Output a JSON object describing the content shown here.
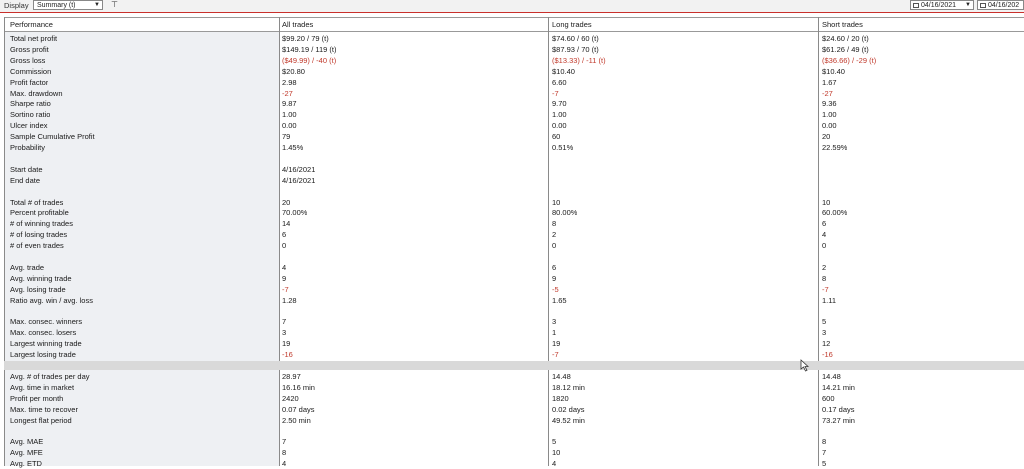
{
  "toolbar": {
    "display_label": "Display",
    "display_value": "Summary (t)",
    "date_from": "04/16/2021",
    "date_to": "04/16/202"
  },
  "columns": [
    "Performance",
    "All trades",
    "Long trades",
    "Short trades"
  ],
  "rows": [
    {
      "label": "Total net profit",
      "all": "$99.20 / 79 (t)",
      "long": "$74.60 / 60 (t)",
      "short": "$24.60 / 20 (t)",
      "neg": false
    },
    {
      "label": "Gross profit",
      "all": "$149.19 / 119 (t)",
      "long": "$87.93 / 70 (t)",
      "short": "$61.26 / 49 (t)",
      "neg": false
    },
    {
      "label": "Gross loss",
      "all": "($49.99) / -40 (t)",
      "long": "($13.33) / -11 (t)",
      "short": "($36.66) / -29 (t)",
      "neg": true
    },
    {
      "label": "Commission",
      "all": "$20.80",
      "long": "$10.40",
      "short": "$10.40",
      "neg": false
    },
    {
      "label": "Profit factor",
      "all": "2.98",
      "long": "6.60",
      "short": "1.67",
      "neg": false
    },
    {
      "label": "Max. drawdown",
      "all": "-27",
      "long": "-7",
      "short": "-27",
      "neg": true
    },
    {
      "label": "Sharpe ratio",
      "all": "9.87",
      "long": "9.70",
      "short": "9.36",
      "neg": false
    },
    {
      "label": "Sortino ratio",
      "all": "1.00",
      "long": "1.00",
      "short": "1.00",
      "neg": false
    },
    {
      "label": "Ulcer index",
      "all": "0.00",
      "long": "0.00",
      "short": "0.00",
      "neg": false
    },
    {
      "label": "Sample Cumulative Profit",
      "all": "79",
      "long": "60",
      "short": "20",
      "neg": false
    },
    {
      "label": "Probability",
      "all": "1.45%",
      "long": "0.51%",
      "short": "22.59%",
      "neg": false
    },
    {
      "label": "",
      "all": "",
      "long": "",
      "short": "",
      "neg": false
    },
    {
      "label": "Start date",
      "all": "4/16/2021",
      "long": "",
      "short": "",
      "neg": false
    },
    {
      "label": "End date",
      "all": "4/16/2021",
      "long": "",
      "short": "",
      "neg": false
    },
    {
      "label": "",
      "all": "",
      "long": "",
      "short": "",
      "neg": false
    },
    {
      "label": "Total # of trades",
      "all": "20",
      "long": "10",
      "short": "10",
      "neg": false
    },
    {
      "label": "Percent profitable",
      "all": "70.00%",
      "long": "80.00%",
      "short": "60.00%",
      "neg": false
    },
    {
      "label": "# of winning trades",
      "all": "14",
      "long": "8",
      "short": "6",
      "neg": false
    },
    {
      "label": "# of losing trades",
      "all": "6",
      "long": "2",
      "short": "4",
      "neg": false
    },
    {
      "label": "# of even trades",
      "all": "0",
      "long": "0",
      "short": "0",
      "neg": false
    },
    {
      "label": "",
      "all": "",
      "long": "",
      "short": "",
      "neg": false
    },
    {
      "label": "Avg. trade",
      "all": "4",
      "long": "6",
      "short": "2",
      "neg": false
    },
    {
      "label": "Avg. winning trade",
      "all": "9",
      "long": "9",
      "short": "8",
      "neg": false
    },
    {
      "label": "Avg. losing trade",
      "all": "-7",
      "long": "-5",
      "short": "-7",
      "neg": true
    },
    {
      "label": "Ratio avg. win / avg. loss",
      "all": "1.28",
      "long": "1.65",
      "short": "1.11",
      "neg": false
    },
    {
      "label": "",
      "all": "",
      "long": "",
      "short": "",
      "neg": false
    },
    {
      "label": "Max. consec. winners",
      "all": "7",
      "long": "3",
      "short": "5",
      "neg": false
    },
    {
      "label": "Max. consec. losers",
      "all": "3",
      "long": "1",
      "short": "3",
      "neg": false
    },
    {
      "label": "Largest winning trade",
      "all": "19",
      "long": "19",
      "short": "12",
      "neg": false
    },
    {
      "label": "Largest losing trade",
      "all": "-16",
      "long": "-7",
      "short": "-16",
      "neg": true
    },
    {
      "label": "",
      "all": "",
      "long": "",
      "short": "",
      "neg": false,
      "sep": true
    },
    {
      "label": "Avg. # of trades per day",
      "all": "28.97",
      "long": "14.48",
      "short": "14.48",
      "neg": false
    },
    {
      "label": "Avg. time in market",
      "all": "16.16 min",
      "long": "18.12 min",
      "short": "14.21 min",
      "neg": false
    },
    {
      "label": "Profit per month",
      "all": "2420",
      "long": "1820",
      "short": "600",
      "neg": false
    },
    {
      "label": "Max. time to recover",
      "all": "0.07 days",
      "long": "0.02 days",
      "short": "0.17 days",
      "neg": false
    },
    {
      "label": "Longest flat period",
      "all": "2.50 min",
      "long": "49.52 min",
      "short": "73.27 min",
      "neg": false
    },
    {
      "label": "",
      "all": "",
      "long": "",
      "short": "",
      "neg": false
    },
    {
      "label": "Avg. MAE",
      "all": "7",
      "long": "5",
      "short": "8",
      "neg": false
    },
    {
      "label": "Avg. MFE",
      "all": "8",
      "long": "10",
      "short": "7",
      "neg": false
    },
    {
      "label": "Avg. ETD",
      "all": "4",
      "long": "4",
      "short": "5",
      "neg": false
    }
  ]
}
